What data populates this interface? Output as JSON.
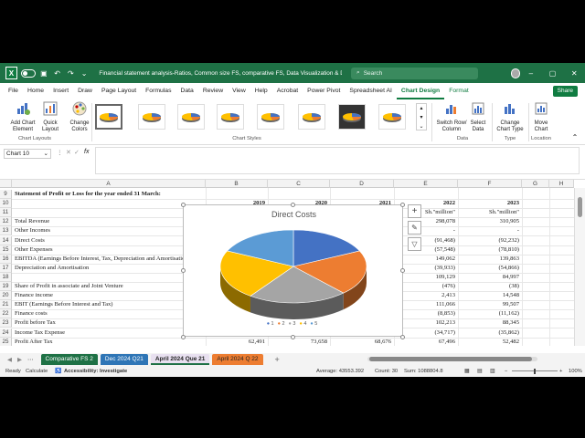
{
  "titlebar": {
    "filename": "Financial statement analysis-Ratios, Common size FS, comparative FS, Data Visualization & Dashboard.xlsx  ·",
    "search_placeholder": "Search",
    "bg_color": "#1e7145"
  },
  "menu_tabs": [
    "File",
    "Home",
    "Insert",
    "Draw",
    "Page Layout",
    "Formulas",
    "Data",
    "Review",
    "View",
    "Help",
    "Acrobat",
    "Power Pivot",
    "Spreadsheet AI",
    "Chart Design",
    "Format"
  ],
  "active_tab": "Chart Design",
  "share_label": "Share",
  "ribbon": {
    "add_chart_element": "Add Chart Element",
    "quick_layout": "Quick Layout",
    "change_colors": "Change Colors",
    "chart_layouts_group": "Chart Layouts",
    "chart_styles_group": "Chart Styles",
    "switch_row_column": "Switch Row/ Column",
    "select_data": "Select Data",
    "data_group": "Data",
    "change_chart_type": "Change Chart Type",
    "type_group": "Type",
    "move_chart": "Move Chart",
    "location_group": "Location"
  },
  "formula_bar": {
    "name_box": "Chart 10",
    "fx": "fx",
    "formula": ""
  },
  "columns": [
    "A",
    "B",
    "C",
    "D",
    "E",
    "F",
    "G",
    "H"
  ],
  "rows": [
    {
      "n": "9",
      "a": "Statement of Profit or Loss for the year ended 31 March:",
      "b": "",
      "c": "",
      "d": "",
      "e": "",
      "f": "",
      "bold": true
    },
    {
      "n": "10",
      "a": "",
      "b": "2019",
      "c": "2020",
      "d": "2021",
      "e": "2022",
      "f": "2023",
      "bold": true
    },
    {
      "n": "11",
      "a": "",
      "b": "",
      "c": "",
      "d": "",
      "e": "Sh.\"million\"",
      "f": "Sh.\"million\""
    },
    {
      "n": "12",
      "a": "Total Revenue",
      "b": "",
      "c": "",
      "d": "",
      "e": "298,078",
      "f": "310,905"
    },
    {
      "n": "13",
      "a": "Other Incomes",
      "b": "",
      "c": "",
      "d": "",
      "e": "-",
      "f": "-"
    },
    {
      "n": "14",
      "a": "Direct Costs",
      "b": "",
      "c": "",
      "d": "",
      "e": "(91,468)",
      "f": "(92,232)"
    },
    {
      "n": "15",
      "a": "Other Expenses",
      "b": "",
      "c": "",
      "d": "",
      "e": "(57,548)",
      "f": "(78,810)"
    },
    {
      "n": "16",
      "a": "EBITDA (Earnings Before Interest, Tax, Depreciation and Amortisation)",
      "b": "",
      "c": "",
      "d": "",
      "e": "149,062",
      "f": "139,863"
    },
    {
      "n": "17",
      "a": "Depreciation and Amortisation",
      "b": "",
      "c": "",
      "d": "",
      "e": "(39,933)",
      "f": "(54,866)"
    },
    {
      "n": "18",
      "a": "",
      "b": "",
      "c": "",
      "d": "",
      "e": "109,129",
      "f": "84,997"
    },
    {
      "n": "19",
      "a": "Share of Profit in associate and Joint Venture",
      "b": "",
      "c": "",
      "d": "",
      "e": "(476)",
      "f": "(38)"
    },
    {
      "n": "20",
      "a": "Finance income",
      "b": "",
      "c": "",
      "d": "",
      "e": "2,413",
      "f": "14,548"
    },
    {
      "n": "21",
      "a": "EBIT (Earnings Before Interest and Tax)",
      "b": "",
      "c": "",
      "d": "",
      "e": "111,066",
      "f": "99,507"
    },
    {
      "n": "22",
      "a": "Finance costs",
      "b": "",
      "c": "",
      "d": "",
      "e": "(8,853)",
      "f": "(11,162)"
    },
    {
      "n": "23",
      "a": "Profit before Tax",
      "b": "",
      "c": "",
      "d": "",
      "e": "102,213",
      "f": "88,345"
    },
    {
      "n": "24",
      "a": "Income Tax Expense",
      "b": "",
      "c": "",
      "d": "",
      "e": "(34,717)",
      "f": "(35,862)"
    },
    {
      "n": "25",
      "a": "Profit After Tax",
      "b": "62,491",
      "c": "73,658",
      "d": "68,676",
      "e": "67,496",
      "f": "52,482"
    }
  ],
  "chart": {
    "title": "Direct Costs",
    "legend": [
      "1",
      "2",
      "3",
      "4",
      "5"
    ],
    "colors": [
      "#4472c4",
      "#ed7d31",
      "#a5a5a5",
      "#ffc000",
      "#5b9bd5"
    ]
  },
  "sheet_tabs": [
    {
      "label": "Comparative FS 2",
      "color": "#1e7145",
      "text": "#fff"
    },
    {
      "label": "Dec 2024 Q21",
      "color": "#2e75b6",
      "text": "#fff"
    },
    {
      "label": "April 2024 Que 21",
      "color": "#e8e0f0",
      "text": "#222"
    },
    {
      "label": "April 2024 Q 22",
      "color": "#ed7d31",
      "text": "#222"
    }
  ],
  "status": {
    "ready": "Ready",
    "calculate": "Calculate",
    "accessibility": "Accessibility: Investigate",
    "average": "Average: 43553.392",
    "count": "Count: 30",
    "sum": "Sum: 1088804.8",
    "zoom": "100%"
  }
}
